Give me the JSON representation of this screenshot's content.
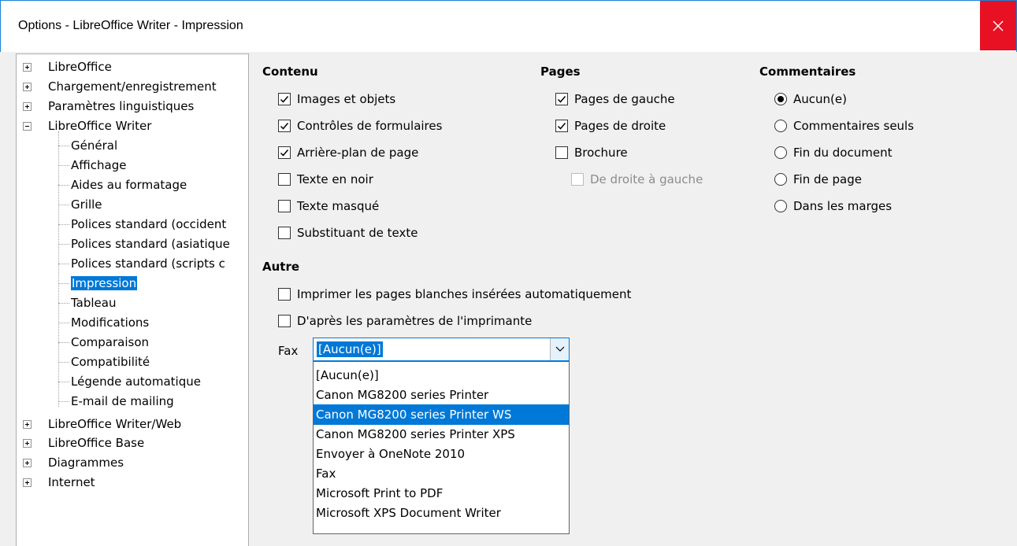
{
  "window": {
    "title": "Options - LibreOffice Writer - Impression",
    "close_icon": "close-icon"
  },
  "tree": {
    "top_items": [
      "LibreOffice",
      "Chargement/enregistrement",
      "Paramètres linguistiques",
      "LibreOffice Writer"
    ],
    "writer_children": [
      "Général",
      "Affichage",
      "Aides au formatage",
      "Grille",
      "Polices standard (occident",
      "Polices standard (asiatique",
      "Polices standard (scripts c",
      "Impression",
      "Tableau",
      "Modifications",
      "Comparaison",
      "Compatibilité",
      "Légende automatique",
      "E-mail de mailing"
    ],
    "bottom_items": [
      "LibreOffice Writer/Web",
      "LibreOffice Base",
      "Diagrammes",
      "Internet"
    ],
    "selected": "Impression"
  },
  "contenu": {
    "title": "Contenu",
    "options": [
      {
        "label": "Images et objets",
        "checked": true
      },
      {
        "label": "Contrôles de formulaires",
        "checked": true
      },
      {
        "label": "Arrière-plan de page",
        "checked": true
      },
      {
        "label": "Texte en noir",
        "checked": false
      },
      {
        "label": "Texte masqué",
        "checked": false
      },
      {
        "label": "Substituant de texte",
        "checked": false
      }
    ]
  },
  "pages": {
    "title": "Pages",
    "options": [
      {
        "label": "Pages de gauche",
        "checked": true
      },
      {
        "label": "Pages de droite",
        "checked": true
      },
      {
        "label": "Brochure",
        "checked": false
      },
      {
        "label": "De droite à gauche",
        "checked": false,
        "disabled": true
      }
    ]
  },
  "commentaires": {
    "title": "Commentaires",
    "options": [
      {
        "label": "Aucun(e)",
        "selected": true
      },
      {
        "label": "Commentaires seuls",
        "selected": false
      },
      {
        "label": "Fin du document",
        "selected": false
      },
      {
        "label": "Fin de page",
        "selected": false
      },
      {
        "label": "Dans les marges",
        "selected": false
      }
    ]
  },
  "autre": {
    "title": "Autre",
    "options": [
      {
        "label": "Imprimer les pages blanches insérées automatiquement",
        "checked": false
      },
      {
        "label": "D'après les paramètres de l'imprimante",
        "checked": false
      }
    ],
    "fax_label": "Fax",
    "fax_value": "[Aucun(e)]",
    "fax_options": [
      "[Aucun(e)]",
      "Canon MG8200 series Printer",
      "Canon MG8200 series Printer WS",
      "Canon MG8200 series Printer XPS",
      "Envoyer à OneNote 2010",
      "Fax",
      "Microsoft Print to PDF",
      "Microsoft XPS Document Writer"
    ],
    "fax_highlighted": "Canon MG8200 series Printer WS"
  },
  "colors": {
    "accent": "#0078d7",
    "close": "#e81123"
  }
}
